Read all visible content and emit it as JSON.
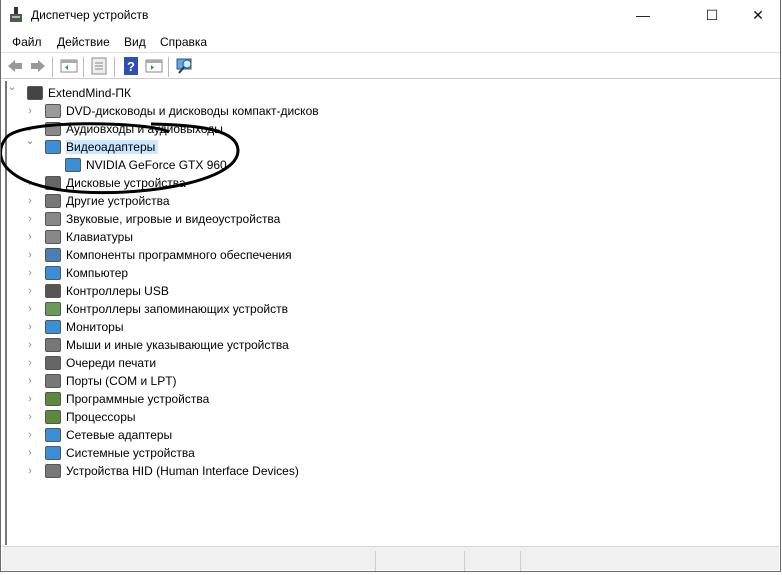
{
  "window": {
    "title": "Диспетчер устройств",
    "minimize": "—",
    "maximize": "☐",
    "close": "✕"
  },
  "menu": [
    "Файл",
    "Действие",
    "Вид",
    "Справка"
  ],
  "toolbar": [
    "back-icon",
    "forward-icon",
    "show-hide-tree-icon",
    "properties-icon",
    "help-icon",
    "update-driver-icon",
    "scan-hardware-icon"
  ],
  "tree": {
    "root": "ExtendMind-ПК",
    "categories": [
      {
        "label": "DVD-дисководы и дисководы компакт-дисков",
        "color": "#9a9a9a"
      },
      {
        "label": "Аудиовходы и аудиовыходы",
        "color": "#8a8a8a"
      },
      {
        "label": "Видеоадаптеры",
        "color": "#3a8fd6",
        "expanded": true,
        "selected": true,
        "children": [
          "NVIDIA GeForce GTX 960"
        ]
      },
      {
        "label": "Дисковые устройства",
        "color": "#666"
      },
      {
        "label": "Другие устройства",
        "color": "#777"
      },
      {
        "label": "Звуковые, игровые и видеоустройства",
        "color": "#888"
      },
      {
        "label": "Клавиатуры",
        "color": "#888"
      },
      {
        "label": "Компоненты программного обеспечения",
        "color": "#4a7fb5"
      },
      {
        "label": "Компьютер",
        "color": "#3a8fd6"
      },
      {
        "label": "Контроллеры USB",
        "color": "#555"
      },
      {
        "label": "Контроллеры запоминающих устройств",
        "color": "#6a9a5a"
      },
      {
        "label": "Мониторы",
        "color": "#3a8fd6"
      },
      {
        "label": "Мыши и иные указывающие устройства",
        "color": "#777"
      },
      {
        "label": "Очереди печати",
        "color": "#666"
      },
      {
        "label": "Порты (COM и LPT)",
        "color": "#777"
      },
      {
        "label": "Программные устройства",
        "color": "#5a8a3a"
      },
      {
        "label": "Процессоры",
        "color": "#5a8a3a"
      },
      {
        "label": "Сетевые адаптеры",
        "color": "#3a8fd6"
      },
      {
        "label": "Системные устройства",
        "color": "#3a8fd6"
      },
      {
        "label": "Устройства HID (Human Interface Devices)",
        "color": "#777"
      }
    ]
  }
}
